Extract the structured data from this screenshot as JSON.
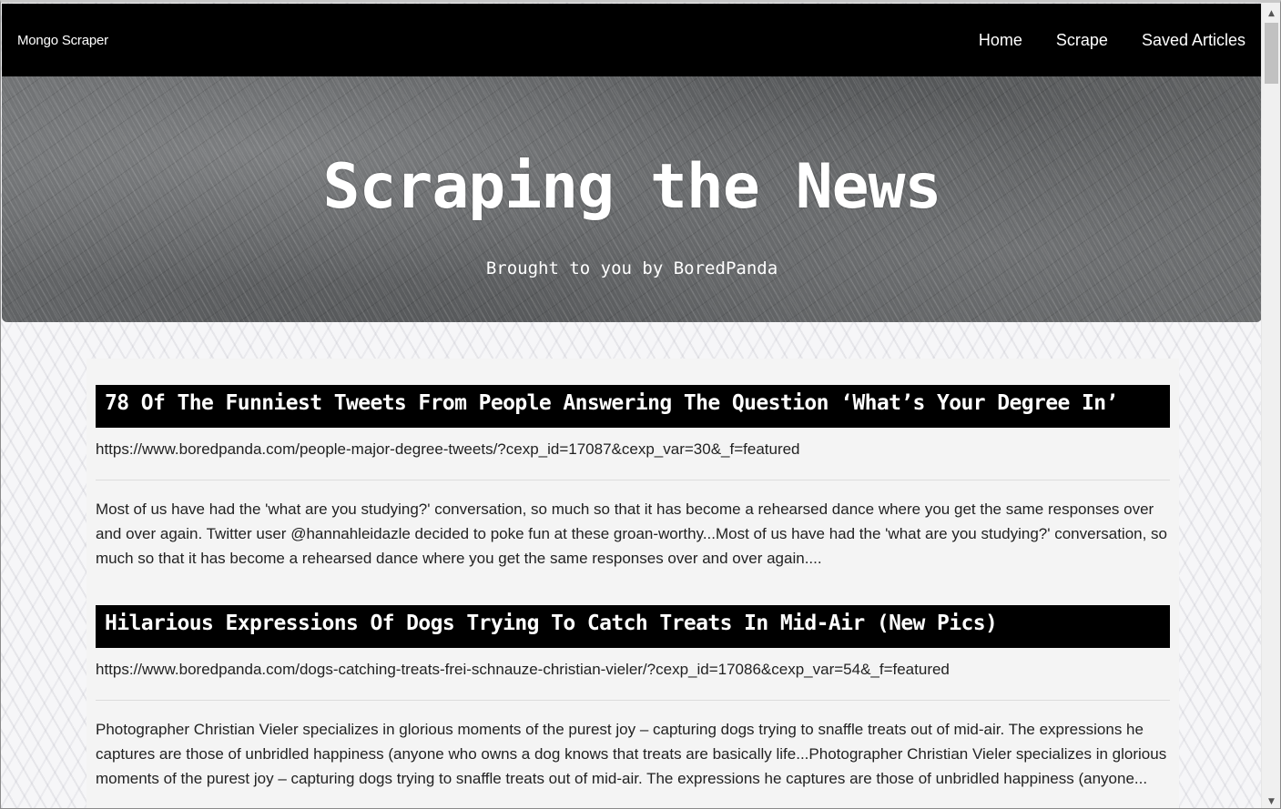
{
  "navbar": {
    "brand": "Mongo Scraper",
    "links": [
      "Home",
      "Scrape",
      "Saved Articles"
    ]
  },
  "hero": {
    "title": "Scraping the News",
    "subtitle": "Brought to you by BoredPanda"
  },
  "articles": [
    {
      "title": "78 Of The Funniest Tweets From People Answering The Question ‘What’s Your Degree In’",
      "url": "https://www.boredpanda.com/people-major-degree-tweets/?cexp_id=17087&cexp_var=30&_f=featured",
      "summary": "Most of us have had the 'what are you studying?' conversation, so much so that it has become a rehearsed dance where you get the same responses over and over again. Twitter user @hannahleidazle decided to poke fun at these groan-worthy...Most of us have had the 'what are you studying?' conversation, so much so that it has become a rehearsed dance where you get the same responses over and over again...."
    },
    {
      "title": "Hilarious Expressions Of Dogs Trying To Catch Treats In Mid-Air (New Pics)",
      "url": "https://www.boredpanda.com/dogs-catching-treats-frei-schnauze-christian-vieler/?cexp_id=17086&cexp_var=54&_f=featured",
      "summary": "Photographer Christian Vieler specializes in glorious moments of the purest joy – capturing dogs trying to snaffle treats out of mid-air. The expressions he captures are those of unbridled happiness (anyone who owns a dog knows that treats are basically life...Photographer Christian Vieler specializes in glorious moments of the purest joy – capturing dogs trying to snaffle treats out of mid-air. The expressions he captures are those of unbridled happiness (anyone..."
    }
  ],
  "scrollbar": {
    "up_icon": "triangle-up",
    "down_icon": "triangle-down"
  }
}
